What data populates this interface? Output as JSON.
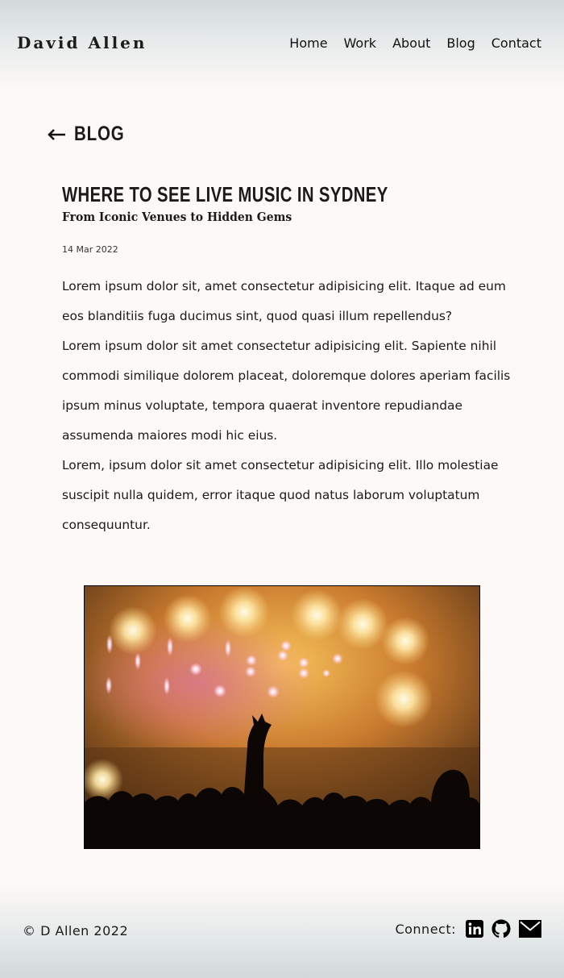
{
  "header": {
    "brand": "David Allen",
    "nav": [
      "Home",
      "Work",
      "About",
      "Blog",
      "Contact"
    ]
  },
  "back_link": {
    "label": "BLOG",
    "icon": "arrow-left-icon"
  },
  "post": {
    "title": "WHERE TO SEE LIVE MUSIC IN SYDNEY",
    "subtitle": "From Iconic Venues to Hidden Gems",
    "date": "14 Mar 2022",
    "paragraphs": [
      "Lorem ipsum dolor sit, amet consectetur adipisicing elit. Itaque ad eum eos blanditiis fuga ducimus sint, quod quasi illum repellendus?",
      "Lorem ipsum dolor sit amet consectetur adipisicing elit. Sapiente nihil commodi similique dolorem placeat, doloremque dolores aperiam facilis ipsum minus voluptate, tempora quaerat inventore repudiandae assumenda maiores modi hic eius.",
      "Lorem, ipsum dolor sit amet consectetur adipisicing elit. Illo molestiae suscipit nulla quidem, error itaque quod natus laborum voluptatum consequuntur."
    ]
  },
  "footer": {
    "copyright": "© D Allen 2022",
    "connect_label": "Connect:",
    "icons": [
      "linkedin-icon",
      "github-icon",
      "mail-icon"
    ]
  }
}
